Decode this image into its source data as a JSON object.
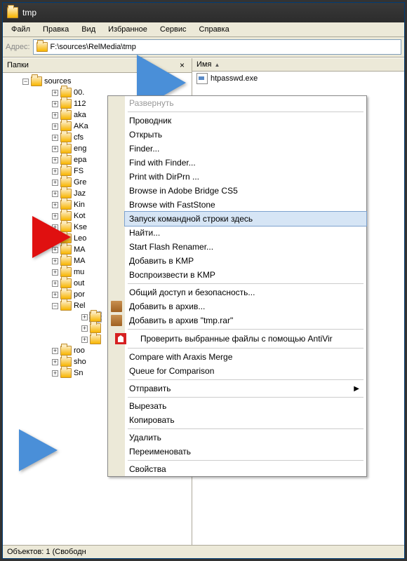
{
  "window": {
    "title": "tmp"
  },
  "menubar": [
    "Файл",
    "Правка",
    "Вид",
    "Избранное",
    "Сервис",
    "Справка"
  ],
  "addressbar": {
    "label": "Адрес:",
    "path": "F:\\sources\\RelMedia\\tmp"
  },
  "leftpane": {
    "header": "Папки",
    "tree": {
      "root": {
        "label": "sources",
        "expanded": true
      },
      "items": [
        {
          "label": "00."
        },
        {
          "label": "112"
        },
        {
          "label": "aka"
        },
        {
          "label": "AKa"
        },
        {
          "label": "cfs"
        },
        {
          "label": "eng"
        },
        {
          "label": "epa"
        },
        {
          "label": "FS"
        },
        {
          "label": "Gre"
        },
        {
          "label": "Jaz"
        },
        {
          "label": "Kin"
        },
        {
          "label": "Kot"
        },
        {
          "label": "Kse"
        },
        {
          "label": "Leo"
        },
        {
          "label": "MA"
        },
        {
          "label": "MA"
        },
        {
          "label": "mu"
        },
        {
          "label": "out"
        },
        {
          "label": "por"
        },
        {
          "label": "Rel",
          "expanded": true,
          "children": [
            {
              "label": "",
              "selected": true
            },
            {
              "label": ""
            },
            {
              "label": ""
            }
          ]
        },
        {
          "label": "roo"
        },
        {
          "label": "sho"
        },
        {
          "label": "Sn"
        }
      ]
    }
  },
  "rightpane": {
    "column_header": "Имя",
    "files": [
      {
        "name": "htpasswd.exe"
      }
    ]
  },
  "statusbar": {
    "text": "Объектов: 1 (Свободн"
  },
  "contextmenu": {
    "items": [
      {
        "label": "Развернуть",
        "disabled": true
      },
      {
        "sep": true
      },
      {
        "label": "Проводник"
      },
      {
        "label": "Открыть"
      },
      {
        "label": "Finder..."
      },
      {
        "label": "Find with Finder..."
      },
      {
        "label": "Print with DirPrn ..."
      },
      {
        "label": "Browse in Adobe Bridge CS5"
      },
      {
        "label": "Browse with FastStone"
      },
      {
        "label": "Запуск командной строки здесь",
        "hovered": true
      },
      {
        "label": "Найти..."
      },
      {
        "label": "Start Flash Renamer..."
      },
      {
        "label": "Добавить в KMP"
      },
      {
        "label": "Воспроизвести в KMP"
      },
      {
        "sep": true
      },
      {
        "label": "Общий доступ и безопасность..."
      },
      {
        "label": "Добавить в архив...",
        "icon": "archive"
      },
      {
        "label": "Добавить в архив \"tmp.rar\"",
        "icon": "archive"
      },
      {
        "sep": true
      },
      {
        "label": "Проверить выбранные файлы с помощью AntiVir",
        "icon": "antivir"
      },
      {
        "sep": true
      },
      {
        "label": "Compare with Araxis Merge"
      },
      {
        "label": "Queue for Comparison"
      },
      {
        "sep": true
      },
      {
        "label": "Отправить",
        "submenu": true
      },
      {
        "sep": true
      },
      {
        "label": "Вырезать"
      },
      {
        "label": "Копировать"
      },
      {
        "sep": true
      },
      {
        "label": "Удалить"
      },
      {
        "label": "Переименовать"
      },
      {
        "sep": true
      },
      {
        "label": "Свойства"
      }
    ]
  }
}
